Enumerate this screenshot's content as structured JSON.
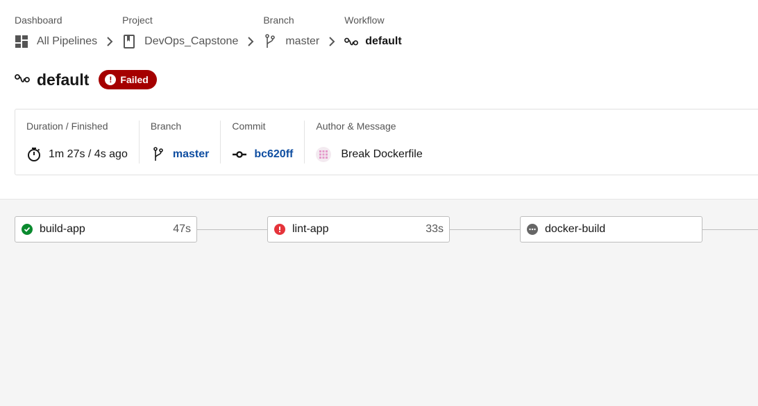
{
  "breadcrumbs": {
    "dashboard": {
      "heading": "Dashboard",
      "label": "All Pipelines",
      "icon": "dashboard-grid-icon"
    },
    "project": {
      "heading": "Project",
      "label": "DevOps_Capstone",
      "icon": "bookmark-icon"
    },
    "branch": {
      "heading": "Branch",
      "label": "master",
      "icon": "branch-icon"
    },
    "workflow": {
      "heading": "Workflow",
      "label": "default",
      "icon": "workflow-icon"
    }
  },
  "workflow": {
    "title": "default",
    "status": "Failed",
    "status_color": "#a50000"
  },
  "summary": {
    "duration": {
      "heading": "Duration / Finished",
      "value": "1m 27s / 4s ago",
      "icon": "stopwatch-icon"
    },
    "branch": {
      "heading": "Branch",
      "value": "master",
      "icon": "branch-icon"
    },
    "commit": {
      "heading": "Commit",
      "value": "bc620ff",
      "icon": "commit-icon"
    },
    "author": {
      "heading": "Author & Message",
      "message": "Break Dockerfile",
      "icon": "avatar"
    }
  },
  "jobs": [
    {
      "name": "build-app",
      "duration": "47s",
      "status": "success",
      "status_color": "#0a8a2e"
    },
    {
      "name": "lint-app",
      "duration": "33s",
      "status": "failed",
      "status_color": "#e5343b"
    },
    {
      "name": "docker-build",
      "duration": "",
      "status": "pending",
      "status_color": "#666666"
    }
  ],
  "colors": {
    "link": "#0f4ea1",
    "canvas_bg": "#f5f5f5"
  }
}
